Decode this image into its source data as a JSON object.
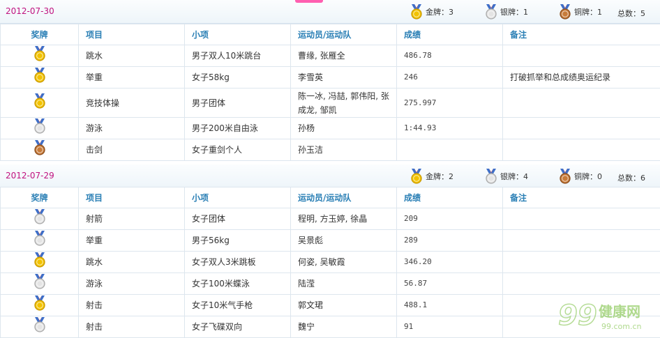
{
  "columns": [
    "奖牌",
    "项目",
    "小项",
    "运动员/运动队",
    "成绩",
    "备注"
  ],
  "tally_labels": {
    "gold": "金牌：",
    "silver": "银牌：",
    "bronze": "铜牌：",
    "total": "总数："
  },
  "days": [
    {
      "date": "2012-07-30",
      "tally": {
        "gold": "3",
        "silver": "1",
        "bronze": "1",
        "total": "5"
      },
      "rows": [
        {
          "medal": "gold",
          "sport": "跳水",
          "event": "男子双人10米跳台",
          "athletes": "曹缘, 张雁全",
          "result": "486.78",
          "note": ""
        },
        {
          "medal": "gold",
          "sport": "举重",
          "event": "女子58kg",
          "athletes": "李雪英",
          "result": "246",
          "note": "打破抓举和总成绩奥运纪录"
        },
        {
          "medal": "gold",
          "sport": "竞技体操",
          "event": "男子团体",
          "athletes": "陈一冰, 冯喆, 郭伟阳, 张成龙, 邹凯",
          "result": "275.997",
          "note": ""
        },
        {
          "medal": "silver",
          "sport": "游泳",
          "event": "男子200米自由泳",
          "athletes": "孙杨",
          "result": "1:44.93",
          "note": ""
        },
        {
          "medal": "bronze",
          "sport": "击剑",
          "event": "女子重剑个人",
          "athletes": "孙玉洁",
          "result": "",
          "note": ""
        }
      ]
    },
    {
      "date": "2012-07-29",
      "tally": {
        "gold": "2",
        "silver": "4",
        "bronze": "0",
        "total": "6"
      },
      "rows": [
        {
          "medal": "silver",
          "sport": "射箭",
          "event": "女子团体",
          "athletes": "程明, 方玉婷, 徐晶",
          "result": "209",
          "note": ""
        },
        {
          "medal": "silver",
          "sport": "举重",
          "event": "男子56kg",
          "athletes": "吴景彪",
          "result": "289",
          "note": ""
        },
        {
          "medal": "gold",
          "sport": "跳水",
          "event": "女子双人3米跳板",
          "athletes": "何姿, 吴敏霞",
          "result": "346.20",
          "note": ""
        },
        {
          "medal": "silver",
          "sport": "游泳",
          "event": "女子100米蝶泳",
          "athletes": "陆滢",
          "result": "56.87",
          "note": ""
        },
        {
          "medal": "gold",
          "sport": "射击",
          "event": "女子10米气手枪",
          "athletes": "郭文珺",
          "result": "488.1",
          "note": ""
        },
        {
          "medal": "silver",
          "sport": "射击",
          "event": "女子飞碟双向",
          "athletes": "魏宁",
          "result": "91",
          "note": ""
        }
      ]
    }
  ],
  "watermark": {
    "digits": "99",
    "brand": "健康网",
    "url": "99.com.cn"
  },
  "colors": {
    "date": "#c0127f",
    "header_text": "#2a7fb5",
    "border": "#dde6ee",
    "gold": "#f2c200",
    "silver": "#e4e4e4",
    "bronze": "#c77b3a",
    "ribbon_red": "#e34b3f",
    "ribbon_blue": "#3d6fc9",
    "watermark": "#7bc043"
  }
}
